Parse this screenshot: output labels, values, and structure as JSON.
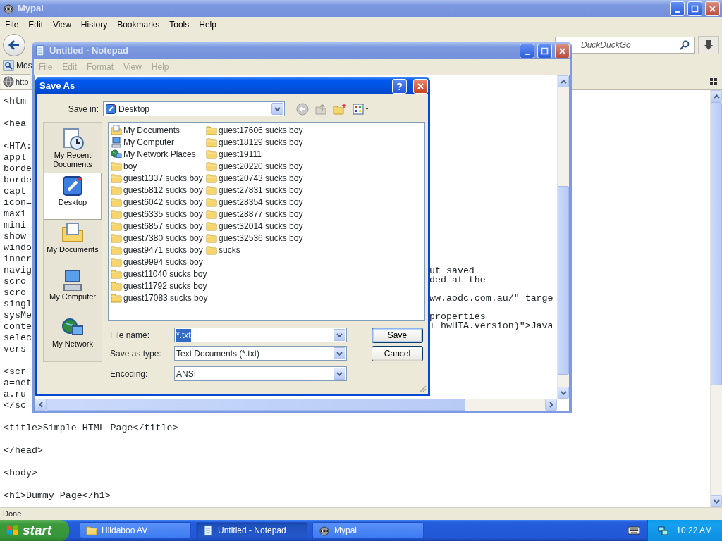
{
  "browser": {
    "title": "Mypal",
    "menu": [
      "File",
      "Edit",
      "View",
      "History",
      "Bookmarks",
      "Tools",
      "Help"
    ],
    "search": {
      "placeholder": "DuckDuckGo"
    },
    "bookmarks": [
      "Mos"
    ],
    "tab": {
      "label": "http"
    },
    "code_blocks": [
      [
        "<htm"
      ],
      [
        "<hea"
      ],
      [
        "<HTA:",
        "appl",
        "borde",
        "borde",
        "capt",
        "icon=",
        "maxi",
        "mini",
        "show",
        "windo",
        "inner",
        "navig",
        "scro",
        "scro",
        "singl",
        "sysMe",
        "conte",
        "selec",
        "vers"
      ],
      [
        "<scr",
        "a=net",
        "a.ru",
        "</sc"
      ],
      [
        "<title>Simple HTML Page</title>"
      ],
      [
        "</head>"
      ],
      [
        "<body>"
      ],
      [
        "<h1>Dummy Page</h1>"
      ]
    ],
    "status": "Done"
  },
  "notepad": {
    "title": "Untitled - Notepad",
    "menu": [
      {
        "label": "File",
        "disabled": true
      },
      {
        "label": "Edit",
        "disabled": true
      },
      {
        "label": "Format",
        "disabled": true
      },
      {
        "label": "View",
        "disabled": true
      },
      {
        "label": "Help",
        "disabled": true
      }
    ],
    "text_blocks": [
      [
        "ut saved",
        "ded at the"
      ],
      [
        "ww.aodc.com.au/\" targe"
      ],
      [
        "properties",
        "+ hwHTA.version)\">Java"
      ]
    ]
  },
  "dialog": {
    "title": "Save As",
    "save_in": {
      "label": "Save in:",
      "value": "Desktop"
    },
    "places": [
      {
        "label": "My Recent Documents",
        "kind": "recent",
        "selected": false
      },
      {
        "label": "Desktop",
        "kind": "desktop",
        "selected": true
      },
      {
        "label": "My Documents",
        "kind": "documents",
        "selected": false
      },
      {
        "label": "My Computer",
        "kind": "computer",
        "selected": false
      },
      {
        "label": "My Network",
        "kind": "network",
        "selected": false
      }
    ],
    "files": [
      {
        "name": "My Documents",
        "kind": "documents"
      },
      {
        "name": "My Computer",
        "kind": "computer"
      },
      {
        "name": "My Network Places",
        "kind": "network"
      },
      {
        "name": "boy",
        "kind": "folder"
      },
      {
        "name": "guest1337 sucks boy",
        "kind": "folder"
      },
      {
        "name": "guest5812 sucks boy",
        "kind": "folder"
      },
      {
        "name": "guest6042 sucks boy",
        "kind": "folder"
      },
      {
        "name": "guest6335 sucks boy",
        "kind": "folder"
      },
      {
        "name": "guest6857 sucks boy",
        "kind": "folder"
      },
      {
        "name": "guest7380 sucks boy",
        "kind": "folder"
      },
      {
        "name": "guest9471 sucks boy",
        "kind": "folder"
      },
      {
        "name": "guest9994 sucks boy",
        "kind": "folder"
      },
      {
        "name": "guest11040 sucks boy",
        "kind": "folder"
      },
      {
        "name": "guest11792 sucks boy",
        "kind": "folder"
      },
      {
        "name": "guest17083 sucks boy",
        "kind": "folder"
      },
      {
        "name": "guest17606 sucks boy",
        "kind": "folder"
      },
      {
        "name": "guest18129 sucks boy",
        "kind": "folder"
      },
      {
        "name": "guest19111",
        "kind": "folder"
      },
      {
        "name": "guest20220 sucks boy",
        "kind": "folder"
      },
      {
        "name": "guest20743 sucks boy",
        "kind": "folder"
      },
      {
        "name": "guest27831 sucks boy",
        "kind": "folder"
      },
      {
        "name": "guest28354 sucks boy",
        "kind": "folder"
      },
      {
        "name": "guest28877 sucks boy",
        "kind": "folder"
      },
      {
        "name": "guest32014 sucks boy",
        "kind": "folder"
      },
      {
        "name": "guest32536 sucks boy",
        "kind": "folder"
      },
      {
        "name": "sucks",
        "kind": "folder"
      }
    ],
    "file_name": {
      "label": "File name:",
      "value": "*.txt",
      "highlighted": true
    },
    "save_as_type": {
      "label": "Save as type:",
      "value": "Text Documents (*.txt)"
    },
    "encoding": {
      "label": "Encoding:",
      "value": "ANSI"
    },
    "buttons": [
      {
        "label": "Save",
        "default": true
      },
      {
        "label": "Cancel",
        "default": false
      }
    ]
  },
  "taskbar": {
    "start": "start",
    "tasks": [
      {
        "label": "Hildaboo AV",
        "kind": "folder",
        "selected": false
      },
      {
        "label": "Untitled - Notepad",
        "kind": "notepad",
        "selected": true
      },
      {
        "label": "Mypal",
        "kind": "animal",
        "selected": false
      }
    ],
    "clock": "10:22 AM"
  }
}
